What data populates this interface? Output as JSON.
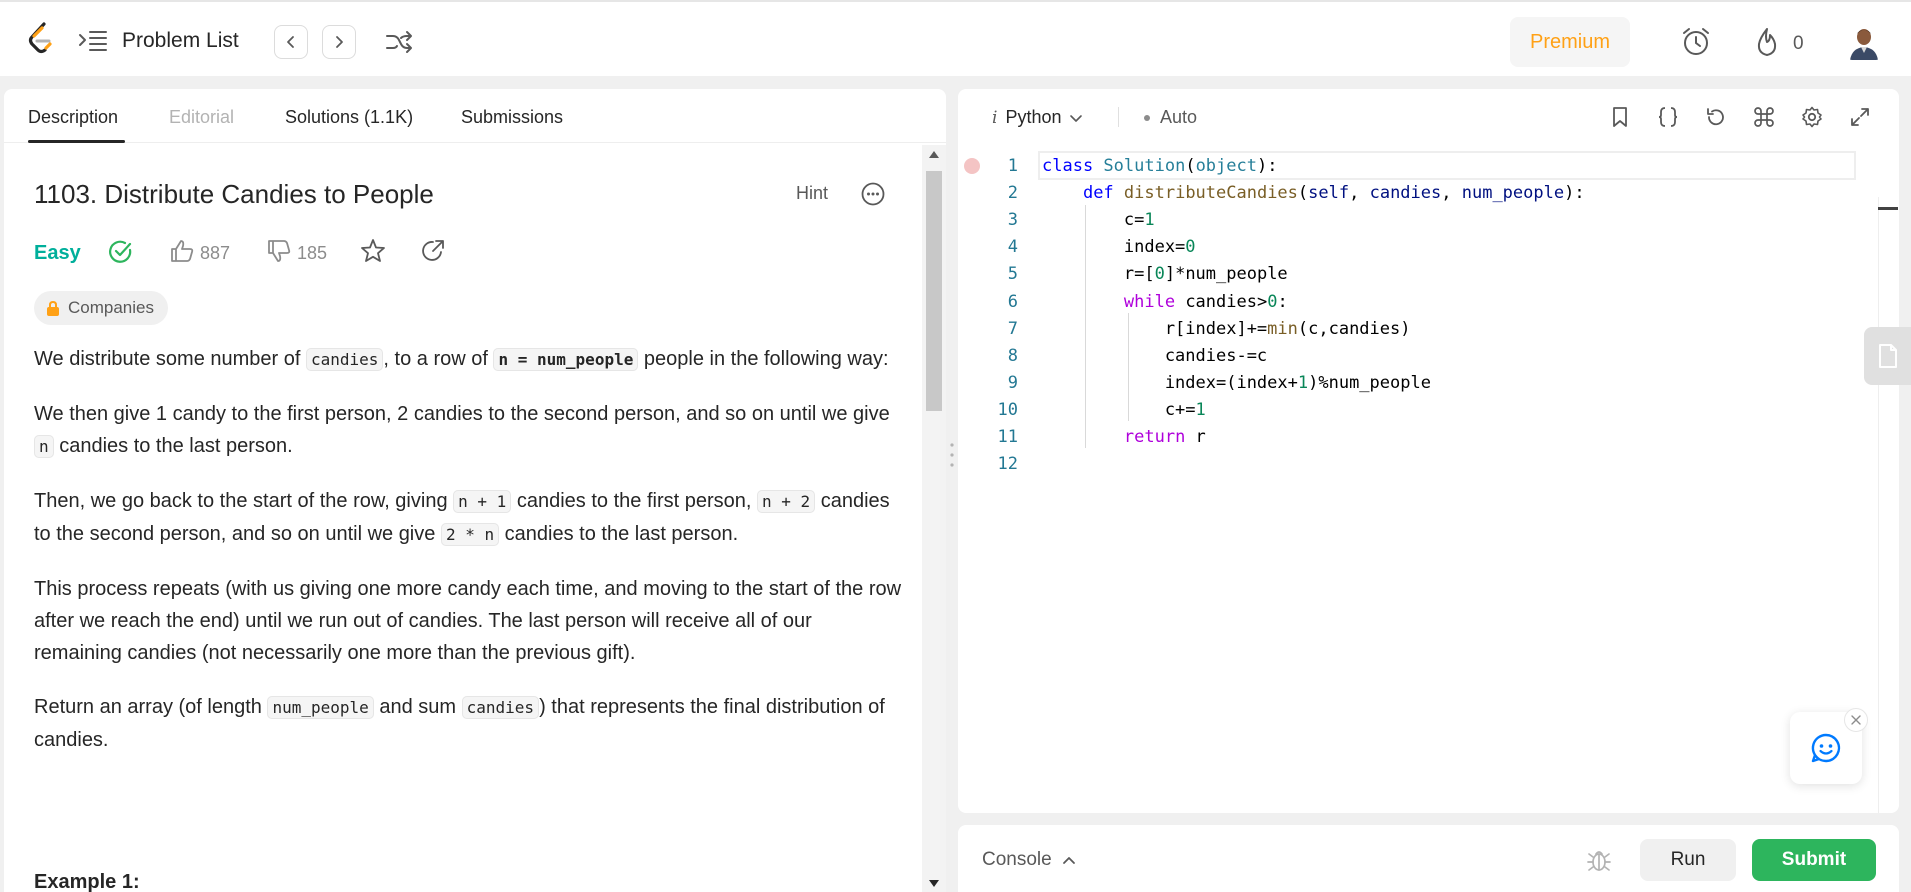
{
  "header": {
    "problem_list_label": "Problem List",
    "premium_label": "Premium",
    "streak_count": "0",
    "colors": {
      "premium": "#ffa116",
      "logo_orange": "#ffa116",
      "logo_dark": "#262626"
    }
  },
  "tabs": [
    {
      "label": "Description",
      "active": true
    },
    {
      "label": "Editorial",
      "disabled": true
    },
    {
      "label": "Solutions (1.1K)"
    },
    {
      "label": "Submissions"
    }
  ],
  "problem": {
    "title": "1103. Distribute Candies to People",
    "hint_label": "Hint",
    "difficulty": "Easy",
    "likes": "887",
    "dislikes": "185",
    "companies_label": "Companies",
    "colors": {
      "easy": "#00af9b",
      "solved": "#2db55d"
    },
    "paragraphs": [
      [
        "We distribute some number of ",
        {
          "code": "candies"
        },
        ", to a row of ",
        {
          "code": "n = num_people",
          "bold": true
        },
        " people in the following way:"
      ],
      [
        "We then give 1 candy to the first person, 2 candies to the second person, and so on until we give ",
        {
          "code": "n"
        },
        " candies to the last person."
      ],
      [
        "Then, we go back to the start of the row, giving ",
        {
          "code": "n + 1"
        },
        " candies to the first person, ",
        {
          "code": "n + 2"
        },
        " candies to the second person, and so on until we give ",
        {
          "code": "2 * n"
        },
        " candies to the last person."
      ],
      [
        "This process repeats (with us giving one more candy each time, and moving to the start of the row after we reach the end) until we run out of candies.  The last person will receive all of our remaining candies (not necessarily one more than the previous gift)."
      ],
      [
        "Return an array (of length ",
        {
          "code": "num_people"
        },
        " and sum ",
        {
          "code": "candies"
        },
        ") that represents the final distribution of candies."
      ]
    ],
    "example_heading": "Example 1:"
  },
  "editor": {
    "language": "Python",
    "language_prefix": "i",
    "mode": "Auto",
    "line_numbers": [
      "1",
      "2",
      "3",
      "4",
      "5",
      "6",
      "7",
      "8",
      "9",
      "10",
      "11",
      "12"
    ],
    "code_lines": [
      [
        [
          "k-blue",
          "class "
        ],
        [
          "k-type",
          "Solution"
        ],
        [
          "",
          "("
        ],
        [
          "k-type",
          "object"
        ],
        [
          "",
          "):"
        ]
      ],
      [
        [
          "",
          "    "
        ],
        [
          "k-blue",
          "def "
        ],
        [
          "k-fn",
          "distributeCandies"
        ],
        [
          "",
          "("
        ],
        [
          "k-param",
          "self"
        ],
        [
          "",
          ", "
        ],
        [
          "k-param",
          "candies"
        ],
        [
          "",
          ", "
        ],
        [
          "k-param",
          "num_people"
        ],
        [
          "",
          "):"
        ]
      ],
      [
        [
          "",
          "        c="
        ],
        [
          "k-num",
          "1"
        ]
      ],
      [
        [
          "",
          "        index="
        ],
        [
          "k-num",
          "0"
        ]
      ],
      [
        [
          "",
          "        r=["
        ],
        [
          "k-num",
          "0"
        ],
        [
          "",
          "]*num_people"
        ]
      ],
      [
        [
          "",
          "        "
        ],
        [
          "k-ctrl",
          "while"
        ],
        [
          "",
          " candies>"
        ],
        [
          "k-num",
          "0"
        ],
        [
          "",
          ":"
        ]
      ],
      [
        [
          "",
          "            r[index]+="
        ],
        [
          "k-fn",
          "min"
        ],
        [
          "",
          "(c,candies)"
        ]
      ],
      [
        [
          "",
          "            candies-=c"
        ]
      ],
      [
        [
          "",
          "            index=(index+"
        ],
        [
          "k-num",
          "1"
        ],
        [
          "",
          ")%num_people"
        ]
      ],
      [
        [
          "",
          "            c+="
        ],
        [
          "k-num",
          "1"
        ]
      ],
      [
        [
          "",
          "        "
        ],
        [
          "k-ctrl",
          "return"
        ],
        [
          "",
          " r"
        ]
      ],
      [
        [
          "",
          ""
        ]
      ]
    ]
  },
  "console": {
    "label": "Console",
    "run_label": "Run",
    "submit_label": "Submit",
    "colors": {
      "submit": "#2db55d"
    }
  }
}
